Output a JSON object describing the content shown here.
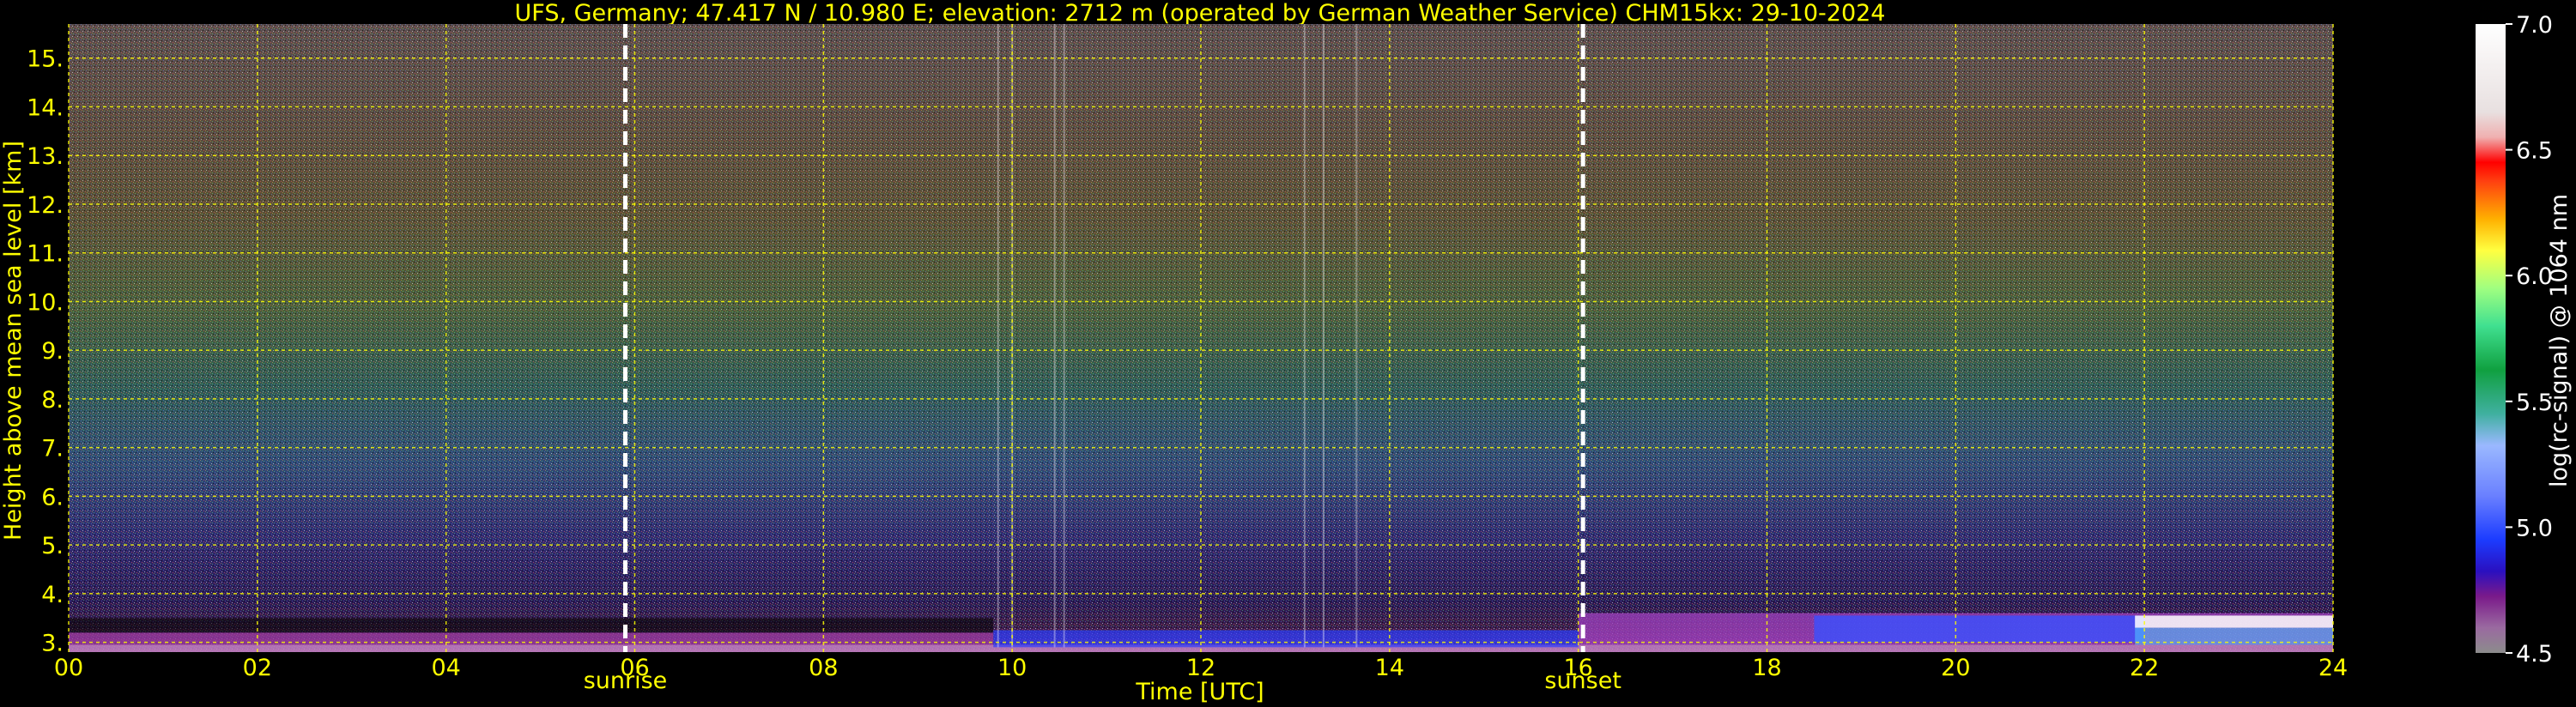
{
  "chart_data": {
    "type": "heatmap",
    "title": "UFS, Germany; 47.417 N / 10.980 E; elevation: 2712 m  (operated by German Weather Service)     CHM15kx: 29-10-2024",
    "xlabel": "Time [UTC]",
    "ylabel": "Height above mean sea level [km]",
    "xlim": [
      0,
      24
    ],
    "ylim": [
      2.8,
      15.7
    ],
    "x_ticks": [
      "00",
      "02",
      "04",
      "06",
      "08",
      "10",
      "12",
      "14",
      "16",
      "18",
      "20",
      "22",
      "24"
    ],
    "y_ticks": [
      "3.",
      "4.",
      "5.",
      "6.",
      "7.",
      "8.",
      "9.",
      "10.",
      "11.",
      "12.",
      "13.",
      "14.",
      "15."
    ],
    "grid": true,
    "events": [
      {
        "label": "sunrise",
        "time": 5.9
      },
      {
        "label": "sunset",
        "time": 16.05
      }
    ],
    "colorbar": {
      "label": "log(rc-signal) @ 1064 nm",
      "range": [
        4.5,
        7.0
      ],
      "ticks": [
        "4.5",
        "5.0",
        "5.5",
        "6.0",
        "6.5",
        "7.0"
      ]
    },
    "colors": {
      "text": "#ffff00",
      "grid": "#ffff00",
      "event_line": "#ffffff",
      "background": "#000000"
    }
  }
}
